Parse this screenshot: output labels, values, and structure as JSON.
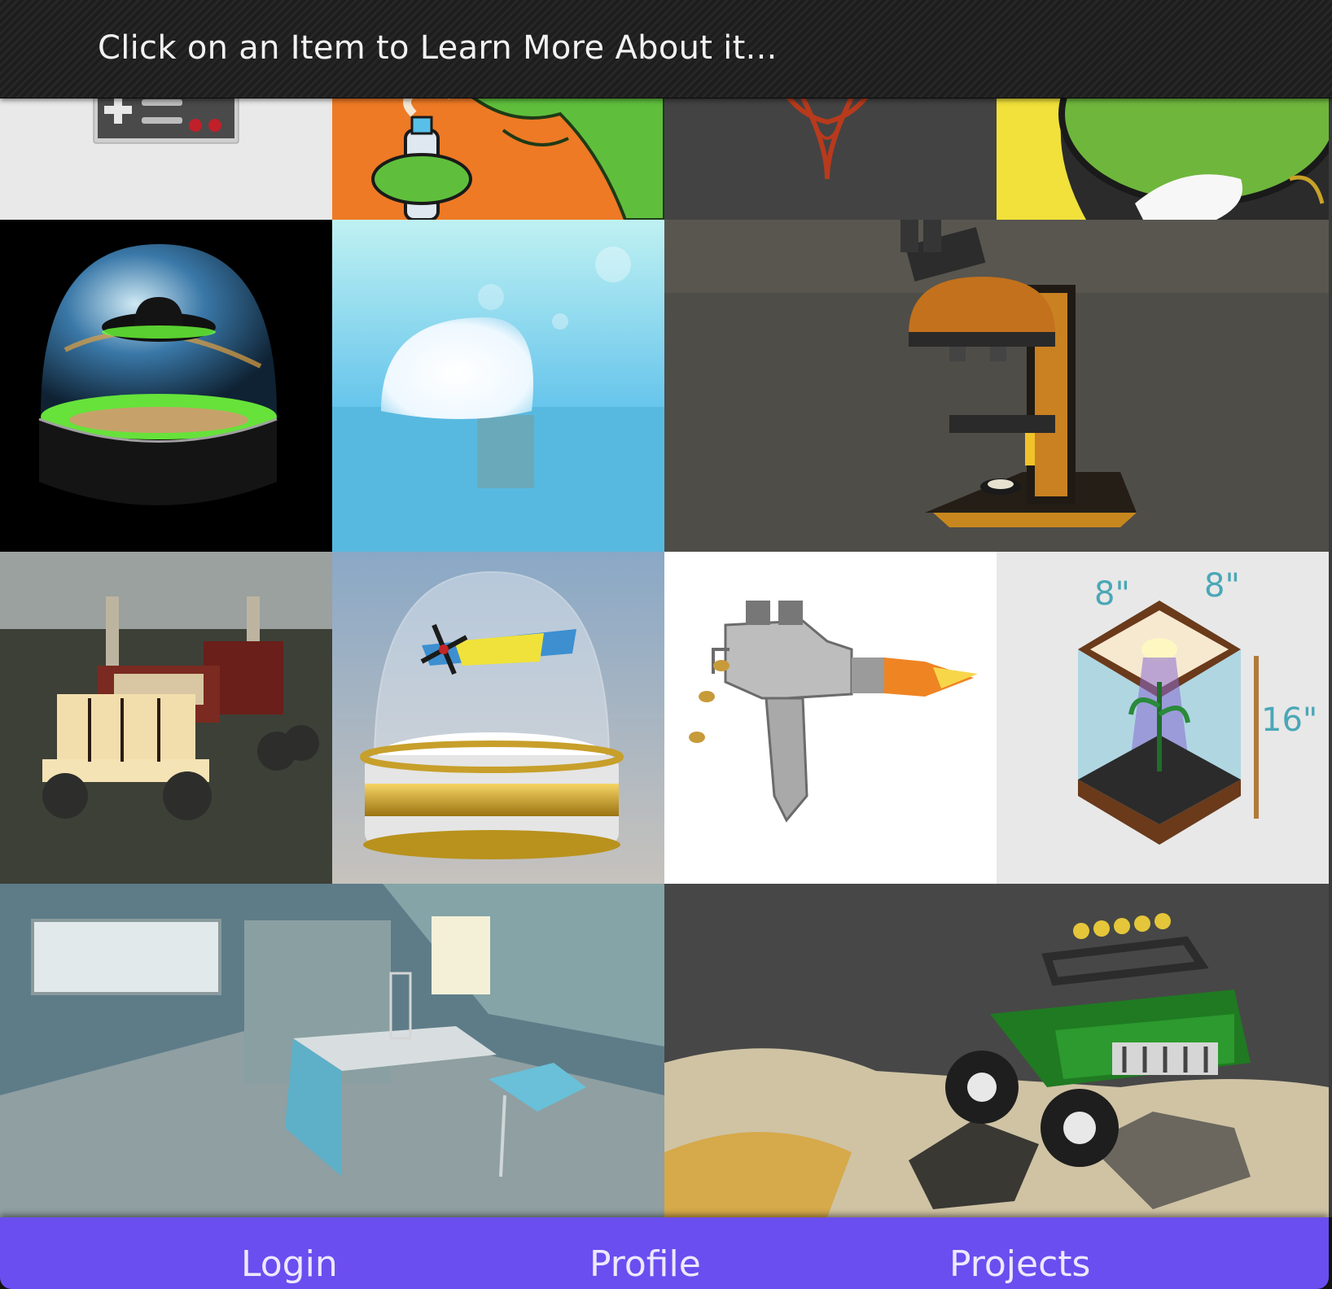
{
  "header": {
    "title": "Click on an Item to Learn More About it..."
  },
  "gallery": {
    "items": [
      {
        "subject": "nes-controller-icon"
      },
      {
        "subject": "green-character-spray-can-icon"
      },
      {
        "subject": "red-ornament-emblem-icon"
      },
      {
        "subject": "green-character-closeup-icon"
      },
      {
        "subject": "ufo-globe-icon"
      },
      {
        "subject": "glowing-mushroom-icon"
      },
      {
        "subject": "microscope-icon"
      },
      {
        "subject": "semi-truck-icon"
      },
      {
        "subject": "airplane-snow-globe-icon"
      },
      {
        "subject": "uzi-gun-icon"
      },
      {
        "subject": "grow-box-icon"
      },
      {
        "subject": "office-room-icon"
      },
      {
        "subject": "green-jeep-icon"
      }
    ]
  },
  "nav": {
    "links": [
      "Login",
      "Profile",
      "Projects"
    ]
  },
  "colors": {
    "nav_background": "#6b4ef0",
    "header_background": "#1d1d1d"
  }
}
